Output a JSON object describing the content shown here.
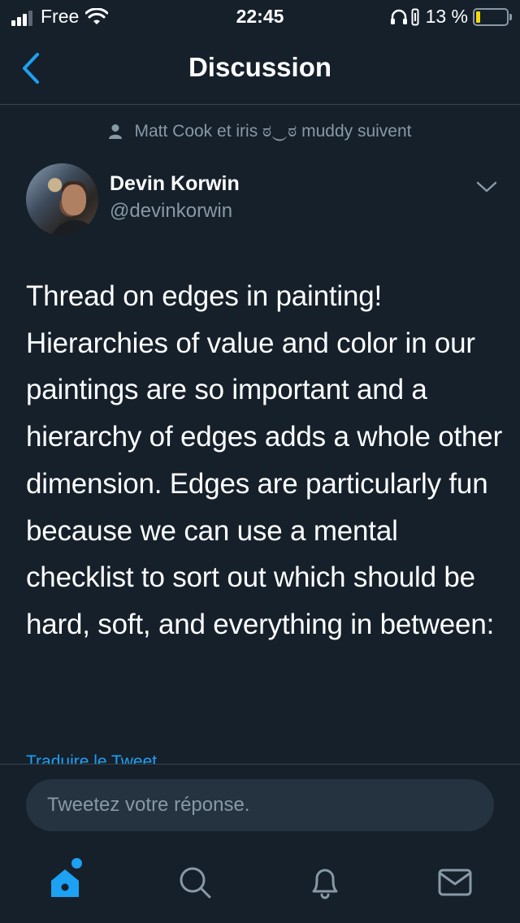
{
  "status_bar": {
    "carrier": "Free",
    "time": "22:45",
    "battery_percent": "13 %",
    "battery_level": 0.13,
    "signal_bars_active": 3,
    "signal_bars_total": 4
  },
  "nav": {
    "title": "Discussion",
    "back_icon": "chevron-left-icon"
  },
  "context": {
    "icon": "person-icon",
    "text": "Matt Cook et iris ಠ‿ಠ muddy suivent"
  },
  "tweet": {
    "author_name": "Devin Korwin",
    "author_handle": "@devinkorwin",
    "text": "Thread on edges in painting! Hierarchies of value and color in our paintings are so important and a hierarchy of edges adds a whole other dimension. Edges are particularly fun because we can use a mental checklist to sort out which should be hard, soft, and everything in between:",
    "translate_link": "Traduire le Tweet"
  },
  "reply": {
    "placeholder": "Tweetez votre réponse."
  },
  "tab_bar": {
    "items": [
      "home-icon",
      "search-icon",
      "notifications-icon",
      "messages-icon"
    ],
    "active": "home-icon"
  },
  "colors": {
    "background": "#15202b",
    "accent": "#1da1f2",
    "secondary_text": "#8899a6",
    "divider": "#38444d"
  }
}
